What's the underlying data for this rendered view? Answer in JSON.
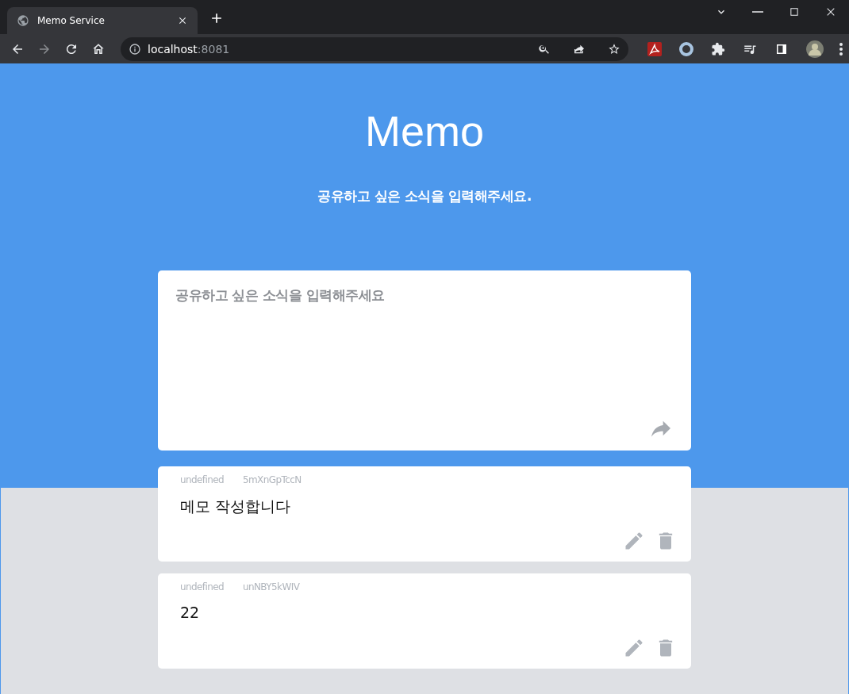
{
  "browser": {
    "tab_title": "Memo Service",
    "url_host": "localhost",
    "url_port": ":8081"
  },
  "header": {
    "title": "Memo",
    "subtitle": "공유하고 싶은 소식을 입력해주세요."
  },
  "composer": {
    "placeholder": "공유하고 싶은 소식을 입력해주세요"
  },
  "memos": [
    {
      "author": "undefined",
      "id": "5mXnGpTccN",
      "text": "메모 작성합니다"
    },
    {
      "author": "undefined",
      "id": "unNBY5kWIV",
      "text": "22"
    }
  ]
}
